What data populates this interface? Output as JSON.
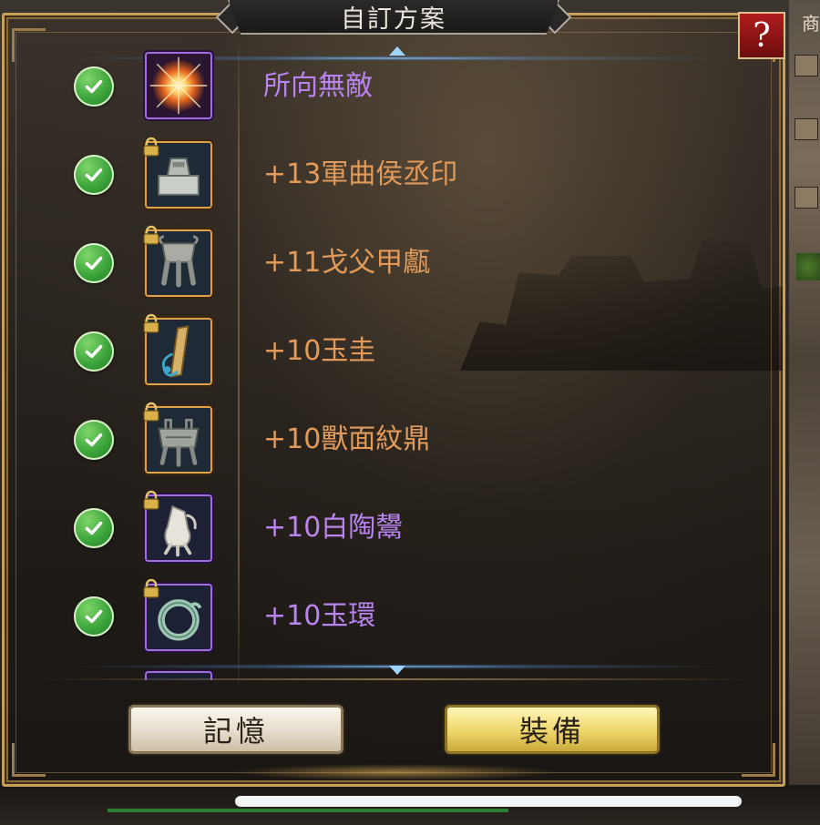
{
  "dialog": {
    "title": "自訂方案",
    "help_label": "?"
  },
  "side_glyph": "商",
  "items": [
    {
      "label": "所向無敵",
      "rarity": "purple",
      "locked": false,
      "checked": true,
      "icon": "radiant-burst-icon"
    },
    {
      "label": "+13軍曲侯丞印",
      "rarity": "orange",
      "locked": true,
      "checked": true,
      "icon": "bronze-seal-icon"
    },
    {
      "label": "+11戈父甲甗",
      "rarity": "orange",
      "locked": true,
      "checked": true,
      "icon": "bronze-steamer-icon"
    },
    {
      "label": "+10玉圭",
      "rarity": "orange",
      "locked": true,
      "checked": true,
      "icon": "jade-tablet-icon"
    },
    {
      "label": "+10獸面紋鼎",
      "rarity": "orange",
      "locked": true,
      "checked": true,
      "icon": "bronze-ding-icon"
    },
    {
      "label": "+10白陶鬹",
      "rarity": "purple",
      "locked": true,
      "checked": true,
      "icon": "white-pottery-jug-icon"
    },
    {
      "label": "+10玉環",
      "rarity": "purple",
      "locked": true,
      "checked": true,
      "icon": "jade-ring-icon"
    }
  ],
  "buttons": {
    "remember_label": "記憶",
    "equip_label": "裝備"
  },
  "colors": {
    "orange_quality": "#e29a5a",
    "purple_quality": "#b983f0",
    "frame_gold": "#c8a05a",
    "check_green": "#3aa33a"
  }
}
